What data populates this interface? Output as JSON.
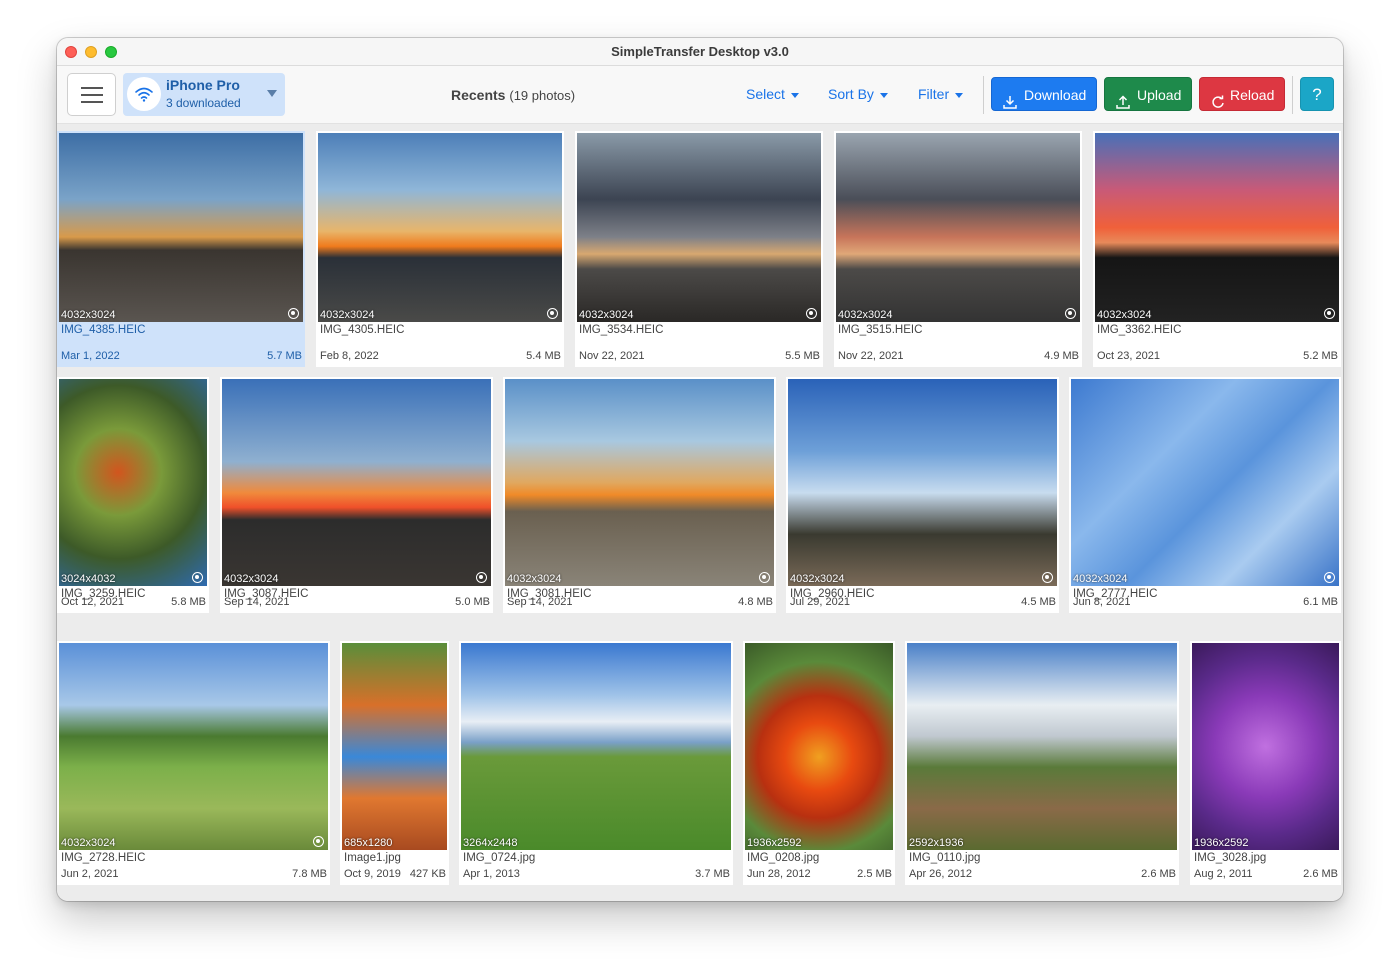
{
  "window": {
    "title": "SimpleTransfer Desktop v3.0"
  },
  "toolbar": {
    "device_name": "iPhone Pro",
    "device_status": "3 downloaded",
    "recents_label": "Recents",
    "recents_count": "(19 photos)",
    "select_label": "Select",
    "sort_label": "Sort By",
    "filter_label": "Filter",
    "download_label": "Download",
    "upload_label": "Upload",
    "reload_label": "Reload",
    "help_label": "?"
  },
  "colors": {
    "accent": "#1a73e8",
    "download": "#1d7bf0",
    "upload": "#1e8a4b",
    "reload": "#dd3742",
    "help": "#1ba6c7",
    "selected_bg": "#cfe2fa"
  },
  "photos": [
    {
      "dims": "4032x3024",
      "name": "IMG_4385.HEIC",
      "date": "Mar 1, 2022",
      "size": "5.7 MB",
      "selected": true,
      "live": true
    },
    {
      "dims": "4032x3024",
      "name": "IMG_4305.HEIC",
      "date": "Feb 8, 2022",
      "size": "5.4 MB",
      "live": true
    },
    {
      "dims": "4032x3024",
      "name": "IMG_3534.HEIC",
      "date": "Nov 22, 2021",
      "size": "5.5 MB",
      "live": true
    },
    {
      "dims": "4032x3024",
      "name": "IMG_3515.HEIC",
      "date": "Nov 22, 2021",
      "size": "4.9 MB",
      "live": true
    },
    {
      "dims": "4032x3024",
      "name": "IMG_3362.HEIC",
      "date": "Oct 23, 2021",
      "size": "5.2 MB",
      "live": true
    },
    {
      "dims": "3024x4032",
      "name": "IMG_3259.HEIC",
      "date": "Oct 12, 2021",
      "size": "5.8 MB",
      "live": true
    },
    {
      "dims": "4032x3024",
      "name": "IMG_3087.HEIC",
      "date": "Sep 14, 2021",
      "size": "5.0 MB",
      "live": true
    },
    {
      "dims": "4032x3024",
      "name": "IMG_3081.HEIC",
      "date": "Sep 14, 2021",
      "size": "4.8 MB",
      "live": true
    },
    {
      "dims": "4032x3024",
      "name": "IMG_2960.HEIC",
      "date": "Jul 29, 2021",
      "size": "4.5 MB",
      "live": true
    },
    {
      "dims": "4032x3024",
      "name": "IMG_2777.HEIC",
      "date": "Jun 8, 2021",
      "size": "6.1 MB",
      "live": true
    },
    {
      "dims": "4032x3024",
      "name": "IMG_2728.HEIC",
      "date": "Jun 2, 2021",
      "size": "7.8 MB",
      "live": true
    },
    {
      "dims": "685x1280",
      "name": "Image1.jpg",
      "date": "Oct 9, 2019",
      "size": "427 KB",
      "live": false
    },
    {
      "dims": "3264x2448",
      "name": "IMG_0724.jpg",
      "date": "Apr 1, 2013",
      "size": "3.7 MB",
      "live": false
    },
    {
      "dims": "1936x2592",
      "name": "IMG_0208.jpg",
      "date": "Jun 28, 2012",
      "size": "2.5 MB",
      "live": false
    },
    {
      "dims": "2592x1936",
      "name": "IMG_0110.jpg",
      "date": "Apr 26, 2012",
      "size": "2.6 MB",
      "live": false
    },
    {
      "dims": "1936x2592",
      "name": "IMG_3028.jpg",
      "date": "Aug 2, 2011",
      "size": "2.6 MB",
      "live": false
    }
  ]
}
